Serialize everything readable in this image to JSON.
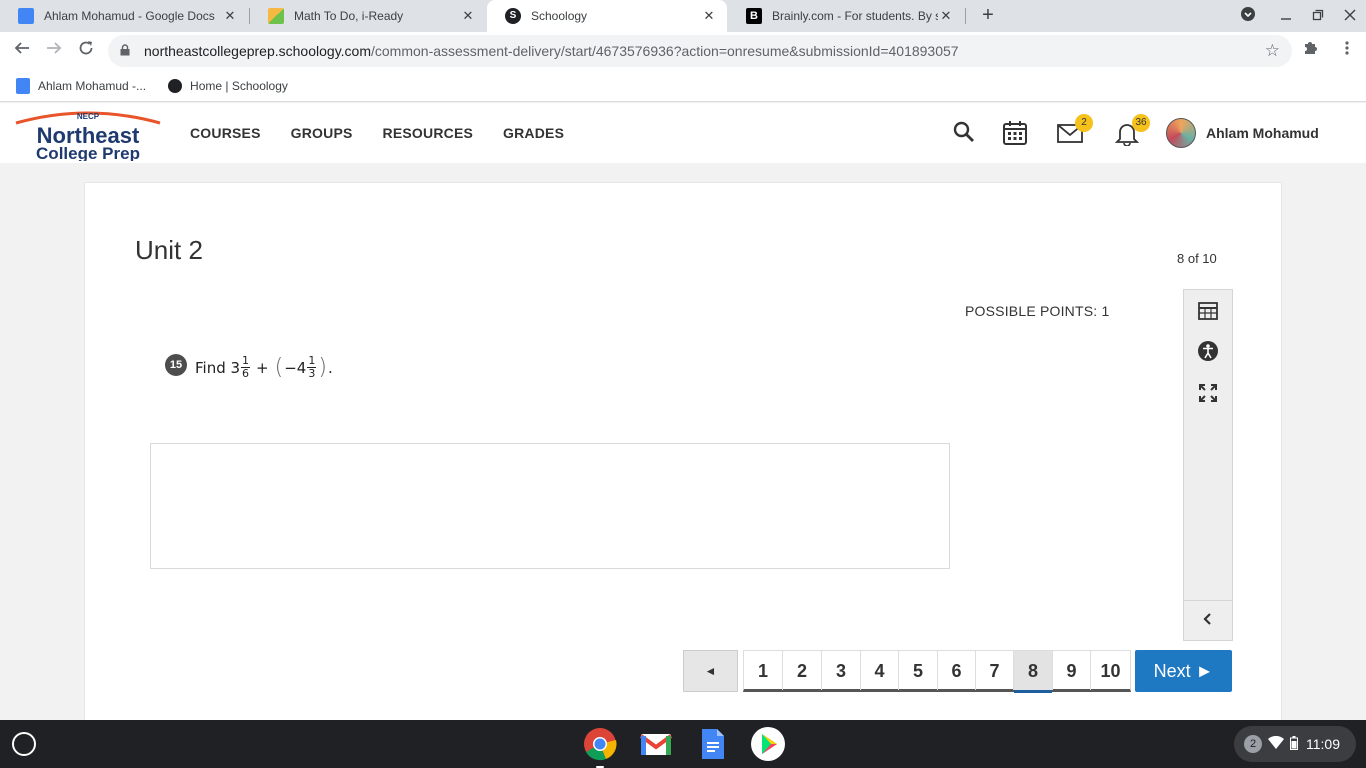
{
  "browser": {
    "tabs": [
      {
        "title": "Ahlam Mohamud - Google Docs",
        "close": "✕"
      },
      {
        "title": "Math To Do, i-Ready",
        "close": "✕"
      },
      {
        "title": "Schoology",
        "close": "✕"
      },
      {
        "title": "Brainly.com - For students. By students.",
        "close": "✕"
      }
    ],
    "new_tab": "+",
    "url_host": "northeastcollegeprep.schoology.com",
    "url_path": "/common-assessment-delivery/start/4673576936?action=onresume&submissionId=401893057",
    "bookmarks": [
      {
        "label": "Ahlam Mohamud -..."
      },
      {
        "label": "Home | Schoology"
      }
    ]
  },
  "header": {
    "logo_top": "NECP",
    "logo_line1": "Northeast",
    "logo_line2": "College Prep",
    "nav": [
      "COURSES",
      "GROUPS",
      "RESOURCES",
      "GRADES"
    ],
    "messages_count": "2",
    "notifications_count": "36",
    "user_name": "Ahlam Mohamud"
  },
  "assessment": {
    "title": "Unit 2",
    "counter": "8 of 10",
    "possible_points": "POSSIBLE POINTS: 1",
    "question_number": "15",
    "question": {
      "prefix": "Find 3",
      "frac1_num": "1",
      "frac1_den": "6",
      "operator": "+",
      "open_paren": "(",
      "neg_whole": "−4",
      "frac2_num": "1",
      "frac2_den": "3",
      "close_paren": ")",
      "suffix": "."
    }
  },
  "pagination": {
    "prev": "◄",
    "pages": [
      "1",
      "2",
      "3",
      "4",
      "5",
      "6",
      "7",
      "8",
      "9",
      "10"
    ],
    "current_page": "8",
    "next": "Next ►"
  },
  "shelf": {
    "notification_count": "2",
    "time": "11:09"
  }
}
